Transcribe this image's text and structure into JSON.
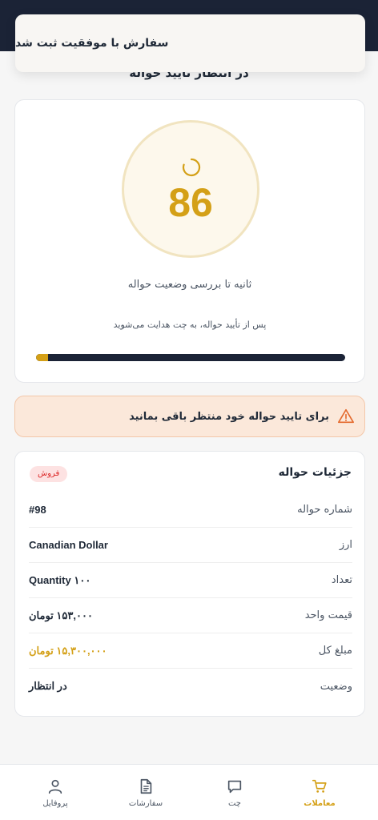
{
  "toast": {
    "message": "سفارش با موفقیت ثبت شد"
  },
  "page": {
    "heading": "در انتظار تایید حواله"
  },
  "timer": {
    "seconds": "86",
    "caption": "ثانیه تا بررسی وضعیت حواله",
    "note": "پس از تأیید حواله، به چت هدایت می‌شوید",
    "progress_percent": 4
  },
  "alert": {
    "text": "برای تایید حواله خود منتظر باقی بمانید",
    "icon": "warning-icon"
  },
  "details": {
    "title": "جزئیات حواله",
    "badge": "فروش",
    "rows": [
      {
        "label": "شماره حواله",
        "value": "#98"
      },
      {
        "label": "ارز",
        "value": "Canadian Dollar"
      },
      {
        "label": "تعداد",
        "value": "۱۰۰ Quantity"
      },
      {
        "label": "قیمت واحد",
        "value": "۱۵۳,۰۰۰ تومان"
      },
      {
        "label": "مبلغ کل",
        "value": "۱۵,۳۰۰,۰۰۰ تومان"
      },
      {
        "label": "وضعیت",
        "value": "در انتظار"
      }
    ]
  },
  "nav": {
    "items": [
      {
        "label": "معاملات",
        "icon": "cart-icon",
        "active": true
      },
      {
        "label": "چت",
        "icon": "chat-icon",
        "active": false
      },
      {
        "label": "سفارشات",
        "icon": "document-icon",
        "active": false
      },
      {
        "label": "پروفایل",
        "icon": "user-icon",
        "active": false
      }
    ]
  },
  "colors": {
    "accent": "#d4a017",
    "dark": "#1b2336",
    "danger": "#dc2626",
    "alert_bg": "#fbe8da"
  }
}
